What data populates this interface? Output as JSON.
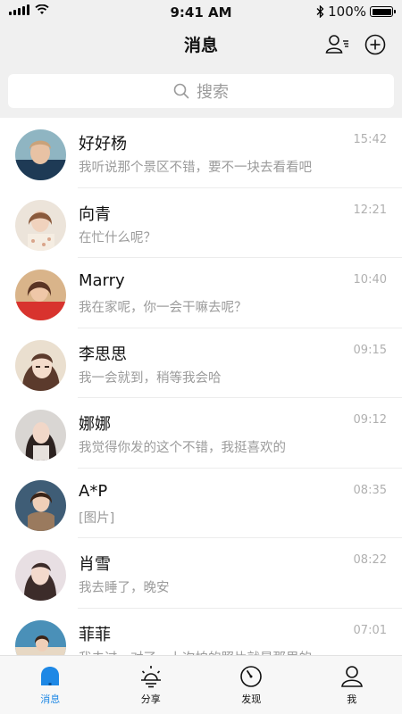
{
  "status": {
    "time": "9:41 AM",
    "battery": "100%",
    "battery_level": 1.0
  },
  "header": {
    "title": "消息",
    "contacts_icon": "contacts-list-icon",
    "add_icon": "add-circle-icon"
  },
  "search": {
    "placeholder": "搜索",
    "icon": "search-icon"
  },
  "chats": [
    {
      "name": "好好杨",
      "message": "我听说那个景区不错，要不一块去看看吧",
      "time": "15:42"
    },
    {
      "name": "向青",
      "message": "在忙什么呢？",
      "time": "12:21"
    },
    {
      "name": "Marry",
      "message": "我在家呢，你一会干嘛去呢？",
      "time": "10:40"
    },
    {
      "name": "李思思",
      "message": "我一会就到，稍等我会哈",
      "time": "09:15"
    },
    {
      "name": "娜娜",
      "message": "我觉得你发的这个不错，我挺喜欢的",
      "time": "09:12"
    },
    {
      "name": "A*P",
      "message": "[图片]",
      "time": "08:35"
    },
    {
      "name": "肖雪",
      "message": "我去睡了，晚安",
      "time": "08:22"
    },
    {
      "name": "菲菲",
      "message": "我去过，对了，上次拍的照片就是那里的",
      "time": "07:01"
    }
  ],
  "tabs": [
    {
      "label": "消息",
      "icon": "message-bell-icon",
      "active": true
    },
    {
      "label": "分享",
      "icon": "sun-icon",
      "active": false
    },
    {
      "label": "发现",
      "icon": "compass-icon",
      "active": false
    },
    {
      "label": "我",
      "icon": "person-icon",
      "active": false
    }
  ],
  "colors": {
    "accent": "#1e88e5",
    "background": "#f0f0f0",
    "text_secondary": "#9b9b9b"
  }
}
